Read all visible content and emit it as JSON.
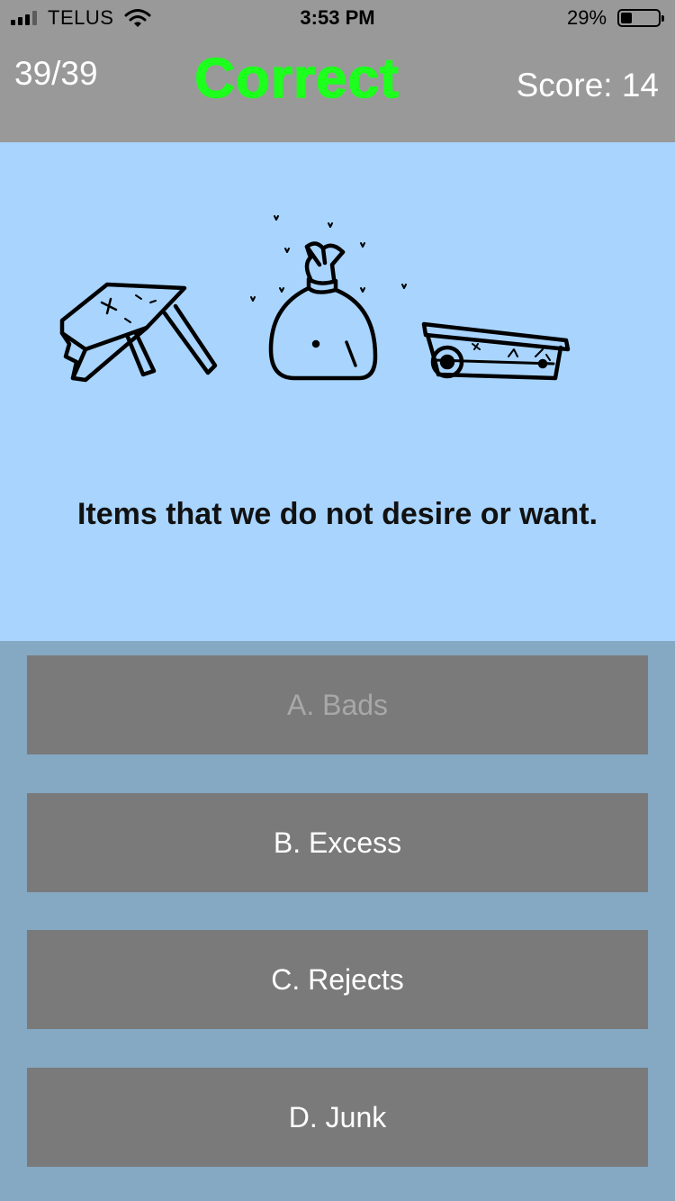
{
  "status_bar": {
    "carrier": "TELUS",
    "time": "3:53 PM",
    "battery_percent": "29%",
    "battery_level": 0.29,
    "signal_bars_filled": 3,
    "signal_bars_total": 4
  },
  "header": {
    "progress": "39/39",
    "feedback": "Correct",
    "score": "Score: 14"
  },
  "question": {
    "text": "Items that we do not desire or want.",
    "illustration_icons": [
      "broken-table-icon",
      "trash-bag-icon",
      "broken-wagon-icon"
    ]
  },
  "answers": [
    {
      "label": "A. Bads",
      "disabled": true
    },
    {
      "label": "B. Excess",
      "disabled": false
    },
    {
      "label": "C. Rejects",
      "disabled": false
    },
    {
      "label": "D. Junk",
      "disabled": false
    }
  ],
  "colors": {
    "header_bg": "#999999",
    "question_bg": "#a8d4fd",
    "answers_bg": "#85a8c3",
    "button_bg": "#7a7a7a",
    "correct_green": "#1dff1d"
  }
}
